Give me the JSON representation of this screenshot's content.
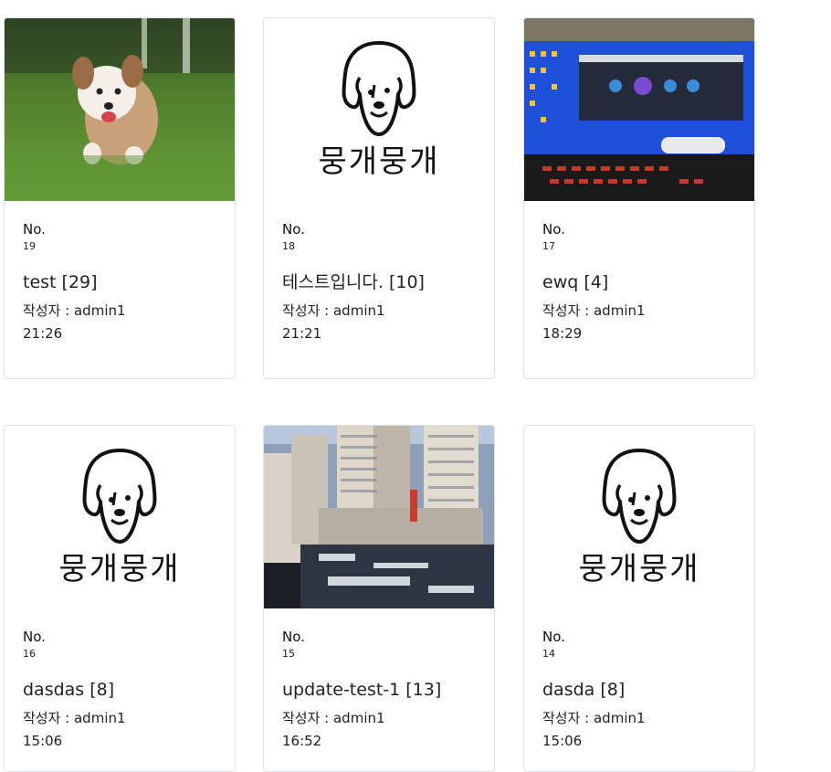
{
  "cards": [
    {
      "no_label": "No.",
      "no": "19",
      "title": "test [29]",
      "writer": "작성자 : admin1",
      "time": "21:26",
      "image": "puppy-photo"
    },
    {
      "no_label": "No.",
      "no": "18",
      "title": "테스트입니다. [10]",
      "writer": "작성자 : admin1",
      "time": "21:21",
      "image": "logo",
      "logo_text": "뭉개뭉개"
    },
    {
      "no_label": "No.",
      "no": "17",
      "title": "ewq [4]",
      "writer": "작성자 : admin1",
      "time": "18:29",
      "image": "desktop-photo"
    },
    {
      "no_label": "No.",
      "no": "16",
      "title": "dasdas [8]",
      "writer": "작성자 : admin1",
      "time": "15:06",
      "image": "logo",
      "logo_text": "뭉개뭉개"
    },
    {
      "no_label": "No.",
      "no": "15",
      "title": "update-test-1 [13]",
      "writer": "작성자 : admin1",
      "time": "16:52",
      "image": "city-photo"
    },
    {
      "no_label": "No.",
      "no": "14",
      "title": "dasda [8]",
      "writer": "작성자 : admin1",
      "time": "15:06",
      "image": "logo",
      "logo_text": "뭉개뭉개"
    }
  ]
}
